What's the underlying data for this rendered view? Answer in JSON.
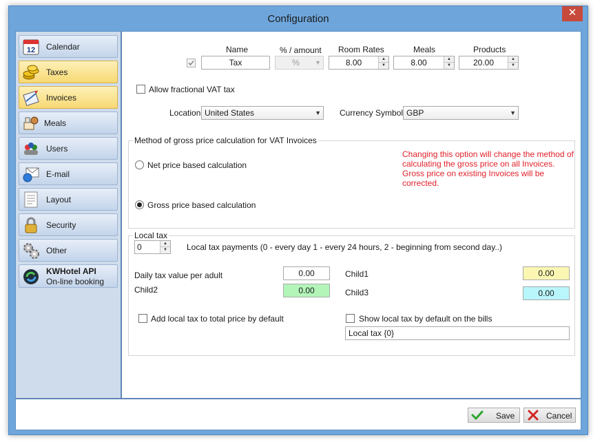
{
  "window": {
    "title": "Configuration",
    "close_glyph": "✕"
  },
  "sidebar": {
    "items": [
      {
        "label": "Calendar",
        "icon": "calendar-icon",
        "badge": "12"
      },
      {
        "label": "Taxes",
        "icon": "coins-icon"
      },
      {
        "label": "Invoices",
        "icon": "invoice-icon"
      },
      {
        "label": "Meals",
        "icon": "meals-icon"
      },
      {
        "label": "Users",
        "icon": "users-icon"
      },
      {
        "label": "E-mail",
        "icon": "email-icon"
      },
      {
        "label": "Layout",
        "icon": "layout-icon"
      },
      {
        "label": "Security",
        "icon": "lock-icon"
      },
      {
        "label": "Other",
        "icon": "gears-icon"
      }
    ],
    "kwhotel": {
      "title": "KWHotel API",
      "subtitle": "On-line booking",
      "icon": "kwhotel-logo-icon"
    }
  },
  "tax_table": {
    "headers": {
      "name": "Name",
      "percent": "% / amount",
      "room_rates": "Room Rates",
      "meals": "Meals",
      "products": "Products"
    },
    "row": {
      "checked": true,
      "name": "Tax",
      "percent": "%",
      "room_rates": "8.00",
      "meals": "8.00",
      "products": "20.00"
    }
  },
  "allow_fractional": {
    "label": "Allow fractional VAT tax",
    "checked": false
  },
  "location": {
    "label": "Location",
    "value": "United States"
  },
  "currency": {
    "label": "Currency Symbol",
    "value": "GBP"
  },
  "gross_method": {
    "title": "Method of gross price calculation for VAT Invoices",
    "net_label": "Net price based calculation",
    "gross_label": "Gross price based calculation",
    "selected": "gross",
    "warning": [
      "Changing this option will change the method of",
      "calculating the gross price on all Invoices.",
      "Gross price on existing Invoices will be corrected."
    ]
  },
  "local_tax": {
    "title": "Local tax",
    "payments_value": "0",
    "payments_label": "Local tax payments (0 - every day 1 - every 24 hours,  2 - beginning from second day..)",
    "daily_adult_label": "Daily tax value per adult",
    "daily_adult_value": "0.00",
    "child1_label": "Child1",
    "child1_value": "0.00",
    "child2_label": "Child2",
    "child2_value": "0.00",
    "child3_label": "Child3",
    "child3_value": "0.00",
    "add_to_total_label": "Add local tax to total price by default",
    "show_on_bills_label": "Show local tax by default on the bills",
    "bill_text": "Local tax {0}"
  },
  "footer": {
    "save_label": "Save",
    "cancel_label": "Cancel"
  },
  "colors": {
    "child1": "#fbf7b3",
    "child2": "#b3f5b9",
    "child3": "#b9f6fb",
    "warning": "#e0202a"
  }
}
